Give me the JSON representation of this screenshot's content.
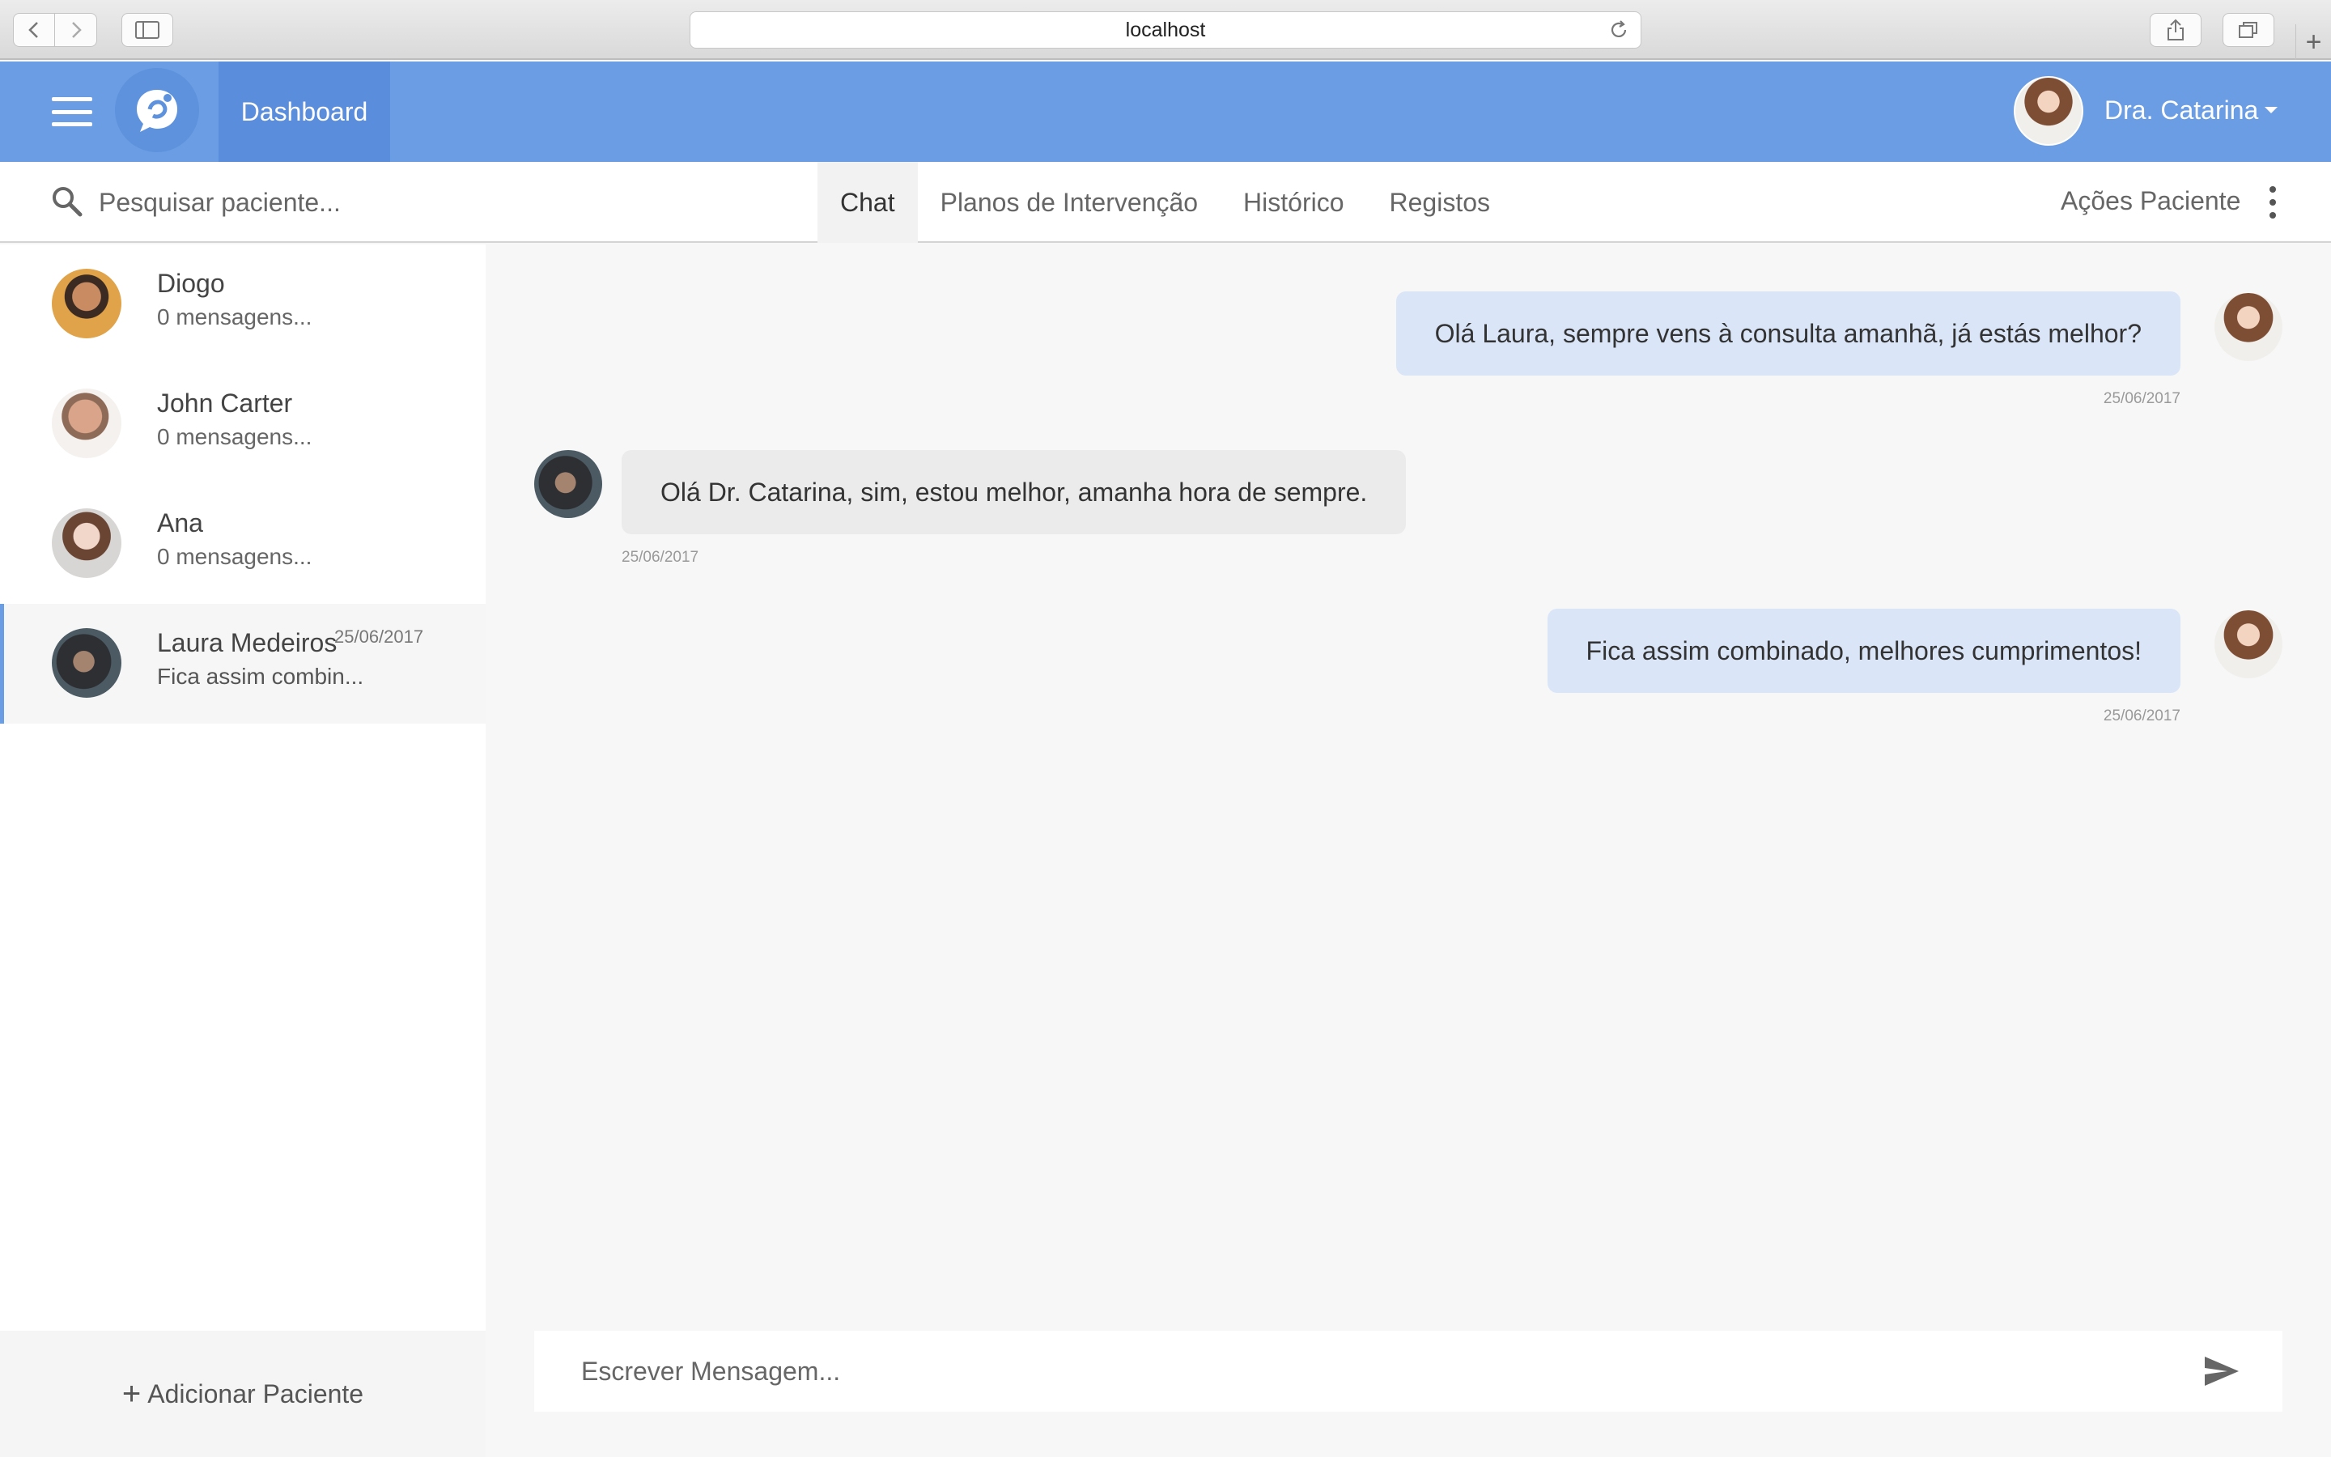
{
  "browser": {
    "url": "localhost"
  },
  "app": {
    "nav_tab": "Dashboard",
    "user_name": "Dra. Catarina"
  },
  "toolbar": {
    "search_placeholder": "Pesquisar paciente...",
    "tabs": [
      {
        "label": "Chat",
        "active": true
      },
      {
        "label": "Planos de Intervenção",
        "active": false
      },
      {
        "label": "Histórico",
        "active": false
      },
      {
        "label": "Registos",
        "active": false
      }
    ],
    "patient_actions": "Ações Paciente"
  },
  "patients": [
    {
      "name": "Diogo",
      "last": "0 mensagens...",
      "date": ""
    },
    {
      "name": "John Carter",
      "last": "0 mensagens...",
      "date": ""
    },
    {
      "name": "Ana",
      "last": "0 mensagens...",
      "date": ""
    },
    {
      "name": "Laura Medeiros",
      "last": "Fica assim combin...",
      "date": "25/06/2017",
      "selected": true
    }
  ],
  "add_patient_label": "Adicionar Paciente",
  "messages": [
    {
      "direction": "out",
      "text": "Olá Laura, sempre vens à consulta amanhã, já estás melhor?",
      "time": "25/06/2017"
    },
    {
      "direction": "in",
      "text": "Olá Dr. Catarina, sim, estou melhor, amanha hora de sempre.",
      "time": "25/06/2017"
    },
    {
      "direction": "out",
      "text": "Fica assim combinado, melhores cumprimentos!",
      "time": "25/06/2017"
    }
  ],
  "composer": {
    "placeholder": "Escrever Mensagem..."
  },
  "colors": {
    "brand": "#6a9de3",
    "brand_dark": "#5a8ddb",
    "bubble_out": "#dae6f8",
    "bubble_in": "#ebebeb"
  }
}
